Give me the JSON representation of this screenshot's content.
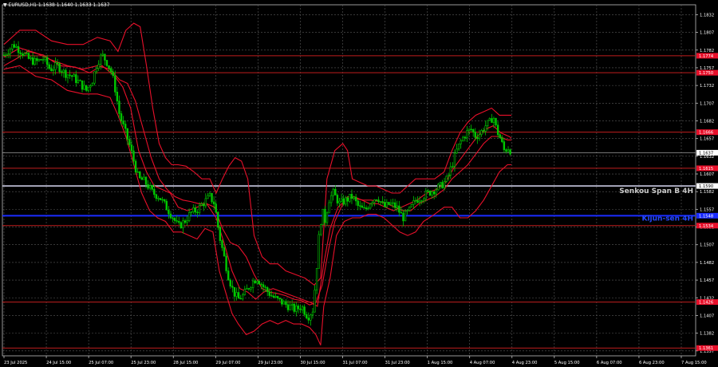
{
  "window": {
    "symbol_title": "▼ EURUSD,H1  1.1638 1.1640 1.1633 1.1637"
  },
  "colors": {
    "background": "#000000",
    "grid": "#5a5a5a",
    "axis": "#c0c0c0",
    "text": "#ffffff",
    "candle": "#00c800",
    "ichimoku_bands": "#e8102a",
    "level_red": "#c01e1e",
    "level_label_bg": "#e8102a",
    "senkou_b_line": "#c8c8e0",
    "kijun_line": "#1a2cff",
    "kijun_text": "#2448ff"
  },
  "chart_data": {
    "type": "candlestick",
    "instrument": "EURUSD",
    "timeframe": "H1",
    "grid": true,
    "ylim": [
      1.135,
      1.1846
    ],
    "y_ticks": [
      "1.1832",
      "1.1807",
      "1.1782",
      "1.1757",
      "1.1732",
      "1.1707",
      "1.1682",
      "1.1657",
      "1.1632",
      "1.1607",
      "1.1582",
      "1.1557",
      "1.1532",
      "1.1507",
      "1.1482",
      "1.1457",
      "1.1432",
      "1.1407",
      "1.1382",
      "1.1357"
    ],
    "x_ticks": [
      "23 Jul 2025",
      "24 Jul 15:00",
      "25 Jul 07:00",
      "25 Jul 23:00",
      "28 Jul 15:00",
      "29 Jul 07:00",
      "29 Jul 23:00",
      "30 Jul 15:00",
      "31 Jul 07:00",
      "31 Jul 23:00",
      "1 Aug 15:00",
      "4 Aug 07:00",
      "4 Aug 23:00",
      "5 Aug 15:00",
      "6 Aug 07:00",
      "6 Aug 23:00",
      "7 Aug 15:00"
    ],
    "current_price": "1.1637",
    "horizontal_levels": [
      {
        "price": 1.1774,
        "label": "1.1774",
        "style": "level"
      },
      {
        "price": 1.175,
        "label": "1.1750",
        "style": "level"
      },
      {
        "price": 1.1666,
        "label": "1.1666",
        "style": "level"
      },
      {
        "price": 1.1615,
        "label": "1.1615",
        "style": "level"
      },
      {
        "price": 1.159,
        "label": "1.1590",
        "style": "senkou"
      },
      {
        "price": 1.1548,
        "label": "1.1548",
        "style": "kijun"
      },
      {
        "price": 1.1534,
        "label": "1.1534",
        "style": "level"
      },
      {
        "price": 1.1426,
        "label": "1.1426",
        "style": "level"
      },
      {
        "price": 1.1361,
        "label": "1.1361",
        "style": "level"
      }
    ],
    "annotations": [
      {
        "text": "Senkou Span B 4H",
        "price": 1.159
      },
      {
        "text": "Kijun-sen 4H",
        "price": 1.1548
      }
    ],
    "close_path": [
      [
        0,
        1.1775
      ],
      [
        12,
        1.179
      ],
      [
        22,
        1.178
      ],
      [
        30,
        1.177
      ],
      [
        40,
        1.1765
      ],
      [
        50,
        1.177
      ],
      [
        58,
        1.1755
      ],
      [
        68,
        1.176
      ],
      [
        76,
        1.175
      ],
      [
        86,
        1.1745
      ],
      [
        96,
        1.1735
      ],
      [
        104,
        1.1725
      ],
      [
        112,
        1.174
      ],
      [
        118,
        1.1765
      ],
      [
        124,
        1.1775
      ],
      [
        130,
        1.1765
      ],
      [
        136,
        1.175
      ],
      [
        140,
        1.173
      ],
      [
        146,
        1.169
      ],
      [
        152,
        1.167
      ],
      [
        158,
        1.165
      ],
      [
        164,
        1.1625
      ],
      [
        170,
        1.16
      ],
      [
        176,
        1.1598
      ],
      [
        182,
        1.159
      ],
      [
        188,
        1.158
      ],
      [
        196,
        1.1575
      ],
      [
        202,
        1.1565
      ],
      [
        208,
        1.1555
      ],
      [
        214,
        1.1545
      ],
      [
        220,
        1.1532
      ],
      [
        228,
        1.154
      ],
      [
        236,
        1.1552
      ],
      [
        244,
        1.1556
      ],
      [
        252,
        1.1566
      ],
      [
        260,
        1.1575
      ],
      [
        266,
        1.1565
      ],
      [
        272,
        1.152
      ],
      [
        278,
        1.149
      ],
      [
        284,
        1.146
      ],
      [
        290,
        1.144
      ],
      [
        296,
        1.143
      ],
      [
        302,
        1.1435
      ],
      [
        308,
        1.1445
      ],
      [
        314,
        1.1455
      ],
      [
        320,
        1.146
      ],
      [
        326,
        1.145
      ],
      [
        332,
        1.1442
      ],
      [
        338,
        1.1435
      ],
      [
        344,
        1.143
      ],
      [
        352,
        1.1425
      ],
      [
        360,
        1.142
      ],
      [
        368,
        1.1415
      ],
      [
        376,
        1.142
      ],
      [
        384,
        1.1405
      ],
      [
        390,
        1.1415
      ],
      [
        394,
        1.146
      ],
      [
        398,
        1.152
      ],
      [
        402,
        1.1555
      ],
      [
        406,
        1.154
      ],
      [
        410,
        1.157
      ],
      [
        416,
        1.158
      ],
      [
        424,
        1.1565
      ],
      [
        432,
        1.157
      ],
      [
        440,
        1.1575
      ],
      [
        448,
        1.156
      ],
      [
        456,
        1.1555
      ],
      [
        464,
        1.157
      ],
      [
        472,
        1.1575
      ],
      [
        480,
        1.156
      ],
      [
        488,
        1.1565
      ],
      [
        496,
        1.156
      ],
      [
        504,
        1.1545
      ],
      [
        512,
        1.1555
      ],
      [
        520,
        1.157
      ],
      [
        528,
        1.1575
      ],
      [
        536,
        1.158
      ],
      [
        544,
        1.1585
      ],
      [
        552,
        1.159
      ],
      [
        560,
        1.16
      ],
      [
        566,
        1.162
      ],
      [
        572,
        1.164
      ],
      [
        578,
        1.1655
      ],
      [
        584,
        1.1665
      ],
      [
        590,
        1.167
      ],
      [
        596,
        1.166
      ],
      [
        602,
        1.1665
      ],
      [
        608,
        1.1675
      ],
      [
        614,
        1.168
      ],
      [
        618,
        1.169
      ],
      [
        622,
        1.167
      ],
      [
        626,
        1.166
      ],
      [
        632,
        1.164
      ],
      [
        638,
        1.1645
      ],
      [
        641,
        1.1637
      ]
    ],
    "band_upper": [
      [
        0,
        1.179
      ],
      [
        20,
        1.181
      ],
      [
        40,
        1.181
      ],
      [
        60,
        1.1795
      ],
      [
        80,
        1.179
      ],
      [
        100,
        1.179
      ],
      [
        118,
        1.18
      ],
      [
        134,
        1.1795
      ],
      [
        144,
        1.178
      ],
      [
        154,
        1.181
      ],
      [
        164,
        1.182
      ],
      [
        172,
        1.1815
      ],
      [
        180,
        1.176
      ],
      [
        188,
        1.17
      ],
      [
        196,
        1.165
      ],
      [
        204,
        1.163
      ],
      [
        212,
        1.162
      ],
      [
        220,
        1.162
      ],
      [
        230,
        1.1618
      ],
      [
        240,
        1.161
      ],
      [
        250,
        1.16
      ],
      [
        260,
        1.16
      ],
      [
        268,
        1.158
      ],
      [
        276,
        1.16
      ],
      [
        284,
        1.1618
      ],
      [
        292,
        1.163
      ],
      [
        300,
        1.1625
      ],
      [
        308,
        1.16
      ],
      [
        316,
        1.152
      ],
      [
        326,
        1.149
      ],
      [
        336,
        1.148
      ],
      [
        346,
        1.148
      ],
      [
        356,
        1.147
      ],
      [
        368,
        1.1465
      ],
      [
        380,
        1.146
      ],
      [
        392,
        1.145
      ],
      [
        400,
        1.146
      ],
      [
        408,
        1.16
      ],
      [
        418,
        1.164
      ],
      [
        428,
        1.165
      ],
      [
        434,
        1.164
      ],
      [
        440,
        1.16
      ],
      [
        450,
        1.1595
      ],
      [
        460,
        1.159
      ],
      [
        470,
        1.159
      ],
      [
        480,
        1.1585
      ],
      [
        490,
        1.158
      ],
      [
        500,
        1.158
      ],
      [
        510,
        1.159
      ],
      [
        520,
        1.16
      ],
      [
        532,
        1.16
      ],
      [
        544,
        1.16
      ],
      [
        556,
        1.161
      ],
      [
        566,
        1.164
      ],
      [
        576,
        1.1665
      ],
      [
        586,
        1.168
      ],
      [
        596,
        1.169
      ],
      [
        606,
        1.1695
      ],
      [
        616,
        1.17
      ],
      [
        626,
        1.169
      ],
      [
        636,
        1.169
      ],
      [
        641,
        1.169
      ]
    ],
    "band_lower": [
      [
        0,
        1.1755
      ],
      [
        20,
        1.176
      ],
      [
        40,
        1.1745
      ],
      [
        60,
        1.174
      ],
      [
        80,
        1.1725
      ],
      [
        100,
        1.172
      ],
      [
        118,
        1.172
      ],
      [
        134,
        1.1715
      ],
      [
        144,
        1.169
      ],
      [
        154,
        1.166
      ],
      [
        164,
        1.162
      ],
      [
        174,
        1.158
      ],
      [
        184,
        1.1555
      ],
      [
        194,
        1.1545
      ],
      [
        204,
        1.154
      ],
      [
        214,
        1.1525
      ],
      [
        224,
        1.1525
      ],
      [
        234,
        1.152
      ],
      [
        244,
        1.1515
      ],
      [
        254,
        1.153
      ],
      [
        264,
        1.1525
      ],
      [
        272,
        1.147
      ],
      [
        280,
        1.144
      ],
      [
        288,
        1.141
      ],
      [
        296,
        1.1395
      ],
      [
        306,
        1.138
      ],
      [
        316,
        1.1385
      ],
      [
        326,
        1.1395
      ],
      [
        336,
        1.14
      ],
      [
        346,
        1.1395
      ],
      [
        356,
        1.14
      ],
      [
        366,
        1.1395
      ],
      [
        376,
        1.1395
      ],
      [
        386,
        1.139
      ],
      [
        394,
        1.138
      ],
      [
        400,
        1.1365
      ],
      [
        404,
        1.142
      ],
      [
        412,
        1.146
      ],
      [
        420,
        1.152
      ],
      [
        430,
        1.154
      ],
      [
        440,
        1.1545
      ],
      [
        450,
        1.1545
      ],
      [
        460,
        1.155
      ],
      [
        470,
        1.155
      ],
      [
        480,
        1.1545
      ],
      [
        490,
        1.1535
      ],
      [
        500,
        1.1525
      ],
      [
        510,
        1.152
      ],
      [
        520,
        1.1525
      ],
      [
        530,
        1.154
      ],
      [
        544,
        1.155
      ],
      [
        556,
        1.156
      ],
      [
        566,
        1.156
      ],
      [
        576,
        1.1545
      ],
      [
        586,
        1.1545
      ],
      [
        596,
        1.1555
      ],
      [
        606,
        1.157
      ],
      [
        616,
        1.159
      ],
      [
        626,
        1.161
      ],
      [
        636,
        1.162
      ],
      [
        641,
        1.162
      ]
    ],
    "band_base": [
      [
        0,
        1.1772
      ],
      [
        20,
        1.1785
      ],
      [
        40,
        1.1778
      ],
      [
        60,
        1.1768
      ],
      [
        80,
        1.176
      ],
      [
        100,
        1.1755
      ],
      [
        118,
        1.176
      ],
      [
        134,
        1.1755
      ],
      [
        146,
        1.174
      ],
      [
        156,
        1.1735
      ],
      [
        166,
        1.171
      ],
      [
        176,
        1.167
      ],
      [
        186,
        1.163
      ],
      [
        196,
        1.16
      ],
      [
        206,
        1.1585
      ],
      [
        216,
        1.1575
      ],
      [
        226,
        1.157
      ],
      [
        236,
        1.1568
      ],
      [
        246,
        1.1565
      ],
      [
        256,
        1.1565
      ],
      [
        266,
        1.156
      ],
      [
        276,
        1.153
      ],
      [
        286,
        1.151
      ],
      [
        296,
        1.1505
      ],
      [
        306,
        1.149
      ],
      [
        316,
        1.1465
      ],
      [
        326,
        1.1445
      ],
      [
        336,
        1.144
      ],
      [
        346,
        1.1438
      ],
      [
        356,
        1.1435
      ],
      [
        366,
        1.143
      ],
      [
        376,
        1.1428
      ],
      [
        386,
        1.1422
      ],
      [
        394,
        1.1425
      ],
      [
        402,
        1.145
      ],
      [
        410,
        1.15
      ],
      [
        418,
        1.154
      ],
      [
        426,
        1.156
      ],
      [
        434,
        1.1575
      ],
      [
        444,
        1.1572
      ],
      [
        454,
        1.157
      ],
      [
        464,
        1.157
      ],
      [
        474,
        1.1568
      ],
      [
        484,
        1.1565
      ],
      [
        494,
        1.156
      ],
      [
        504,
        1.1555
      ],
      [
        514,
        1.1555
      ],
      [
        524,
        1.1565
      ],
      [
        534,
        1.157
      ],
      [
        544,
        1.1575
      ],
      [
        556,
        1.1585
      ],
      [
        566,
        1.16
      ],
      [
        576,
        1.161
      ],
      [
        586,
        1.162
      ],
      [
        596,
        1.1635
      ],
      [
        606,
        1.165
      ],
      [
        616,
        1.166
      ],
      [
        626,
        1.166
      ],
      [
        636,
        1.1655
      ],
      [
        641,
        1.1655
      ]
    ],
    "band_extra": [
      [
        0,
        1.176
      ],
      [
        16,
        1.177
      ],
      [
        30,
        1.178
      ],
      [
        50,
        1.1775
      ],
      [
        70,
        1.176
      ],
      [
        90,
        1.1758
      ],
      [
        108,
        1.175
      ],
      [
        124,
        1.176
      ],
      [
        140,
        1.1745
      ],
      [
        150,
        1.173
      ],
      [
        160,
        1.17
      ],
      [
        170,
        1.164
      ],
      [
        180,
        1.161
      ],
      [
        190,
        1.159
      ],
      [
        200,
        1.1585
      ],
      [
        210,
        1.158
      ],
      [
        220,
        1.156
      ],
      [
        232,
        1.1555
      ],
      [
        244,
        1.156
      ],
      [
        256,
        1.1565
      ],
      [
        268,
        1.1545
      ],
      [
        278,
        1.151
      ],
      [
        288,
        1.147
      ],
      [
        298,
        1.1445
      ],
      [
        308,
        1.144
      ],
      [
        318,
        1.143
      ],
      [
        328,
        1.144
      ],
      [
        340,
        1.1445
      ],
      [
        352,
        1.144
      ],
      [
        364,
        1.1435
      ],
      [
        376,
        1.143
      ],
      [
        388,
        1.1425
      ],
      [
        396,
        1.142
      ],
      [
        404,
        1.148
      ],
      [
        412,
        1.153
      ],
      [
        422,
        1.156
      ],
      [
        432,
        1.157
      ],
      [
        442,
        1.1575
      ],
      [
        452,
        1.157
      ],
      [
        462,
        1.1565
      ],
      [
        472,
        1.1565
      ],
      [
        482,
        1.156
      ],
      [
        492,
        1.1555
      ],
      [
        502,
        1.156
      ],
      [
        512,
        1.1565
      ],
      [
        522,
        1.157
      ],
      [
        534,
        1.158
      ],
      [
        546,
        1.1585
      ],
      [
        558,
        1.1595
      ],
      [
        568,
        1.1615
      ],
      [
        578,
        1.163
      ],
      [
        588,
        1.1645
      ],
      [
        598,
        1.166
      ],
      [
        608,
        1.167
      ],
      [
        618,
        1.1675
      ],
      [
        628,
        1.1665
      ],
      [
        638,
        1.166
      ],
      [
        641,
        1.1658
      ]
    ]
  }
}
